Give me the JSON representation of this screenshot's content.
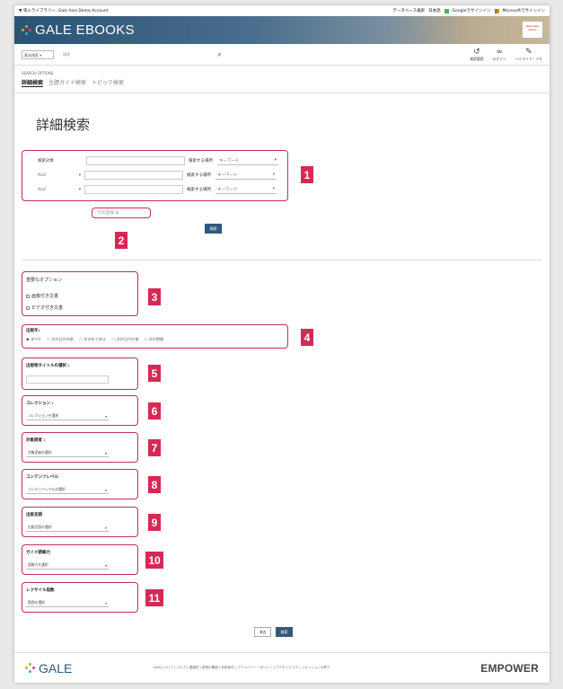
{
  "topbar": {
    "left_text": "▼ 導入ライブラリー: Gale Asia Demo Account",
    "right_items": [
      "データベース検索",
      "日本語"
    ],
    "google_signin": "Googleでサインイン",
    "ms_signin": "Microsoftでサインイン"
  },
  "banner": {
    "brand": "GALE EBOOKS",
    "inst_logo": "Gale Asia Demo"
  },
  "searchbar": {
    "scope_select": "基本検索",
    "placeholder": "検索",
    "icons": [
      {
        "label": "検索履歴",
        "icon": "history-icon"
      },
      {
        "label": "ログイン",
        "icon": "link-icon"
      },
      {
        "label": "ハイライト・メモ",
        "icon": "pen-icon"
      }
    ]
  },
  "search_options": {
    "heading": "SEARCH OPTIONS",
    "tabs": [
      "詳細検索",
      "主題ガイド検索",
      "トピック検索"
    ]
  },
  "page_title": "詳細検索",
  "criteria": {
    "first_label": "検索対象",
    "operator": "And",
    "where_label": "検索する場所",
    "field_value": "キーワード",
    "add_row": "行の追加 ⊕",
    "search_button": "検索"
  },
  "limits": {
    "options_title": "重要なオプション",
    "opt_images": "画像付き文書",
    "opt_videos": "ビデオ付き文書",
    "pubdate_label": "出版年:",
    "pubdate_options": [
      "すべて",
      "次の日付の前",
      "次の年である",
      "次の日付の後",
      "次の期間"
    ],
    "pubtitle_label": "出版物タイトルの選択 :",
    "collection_label": "コレクション :",
    "collection_value": "コレクションを選択",
    "audience_label": "対象読者 :",
    "audience_value": "対象読者の選択",
    "content_level_label": "コンテンツレベル",
    "content_level_value": "コンテンツレベルの選択",
    "pub_lang_label": "出版言語",
    "pub_lang_value": "出版言語の選択",
    "guide_label": "ガイド読解力",
    "guide_value": "読解力を選択",
    "lexile_label": "レクサイル指数",
    "lexile_value": "範囲を選択",
    "clear_button": "消去",
    "search_button": "検索"
  },
  "callouts": [
    "1",
    "2",
    "3",
    "4",
    "5",
    "6",
    "7",
    "8",
    "9",
    "10",
    "11"
  ],
  "footer": {
    "brand": "GALE",
    "links": "Galeについて | ヘルプ | 連絡先 | 説明の確認 | 利用条件 | プライバシー・ポリシー | アクセシビリティ | セッションの終了",
    "empower": "EMPOWER"
  },
  "colors": {
    "callout": "#d42a55",
    "button": "#2f5a7d",
    "banner": "#2b5273"
  }
}
